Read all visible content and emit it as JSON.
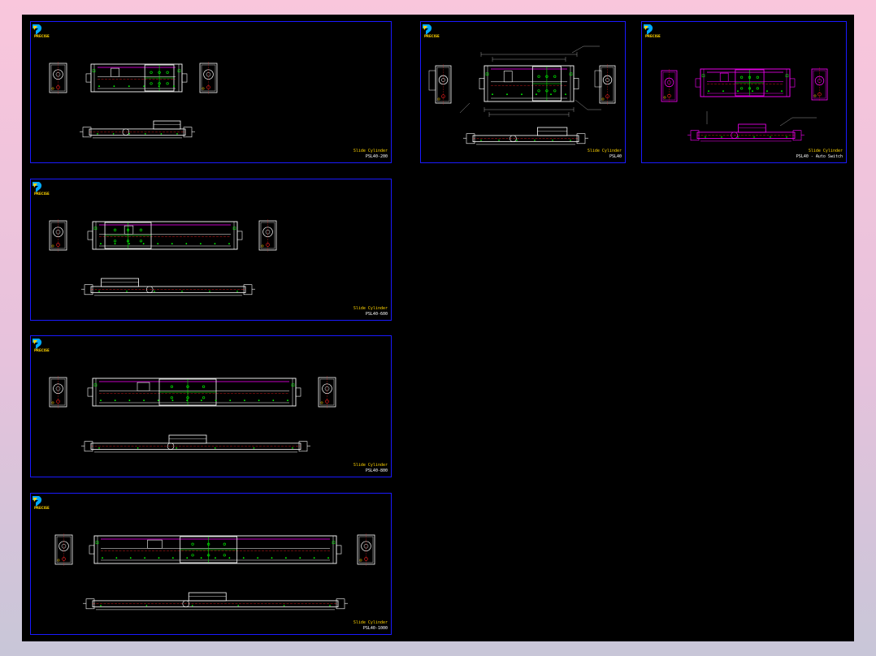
{
  "sheets": [
    {
      "id": "s1",
      "brand": "PRECISE",
      "title": "Slide Cylinder",
      "model": "PSL40-200",
      "stroke": 200
    },
    {
      "id": "s2",
      "brand": "PRECISE",
      "title": "Slide Cylinder",
      "model": "PSL40-600",
      "stroke": 600
    },
    {
      "id": "s3",
      "brand": "PRECISE",
      "title": "Slide Cylinder",
      "model": "PSL40-800",
      "stroke": 800
    },
    {
      "id": "s4",
      "brand": "PRECISE",
      "title": "Slide Cylinder",
      "model": "PSL40-1000",
      "stroke": 1000
    },
    {
      "id": "s5",
      "brand": "PRECISE",
      "title": "Slide Cylinder",
      "model": "PSL40",
      "stroke": 0
    },
    {
      "id": "s6",
      "brand": "PRECISE",
      "title": "Slide Cylinder",
      "model": "PSL40 - Auto Switch",
      "stroke": 0
    }
  ],
  "colors": {
    "background": "#000000",
    "frame": "#1a1aff",
    "outline": "#ffffff",
    "accent_magenta": "#ff00ff",
    "accent_green": "#00ff00",
    "accent_red": "#ff2020",
    "title_yellow": "#ffd400",
    "logo_cyan": "#00aaff"
  }
}
